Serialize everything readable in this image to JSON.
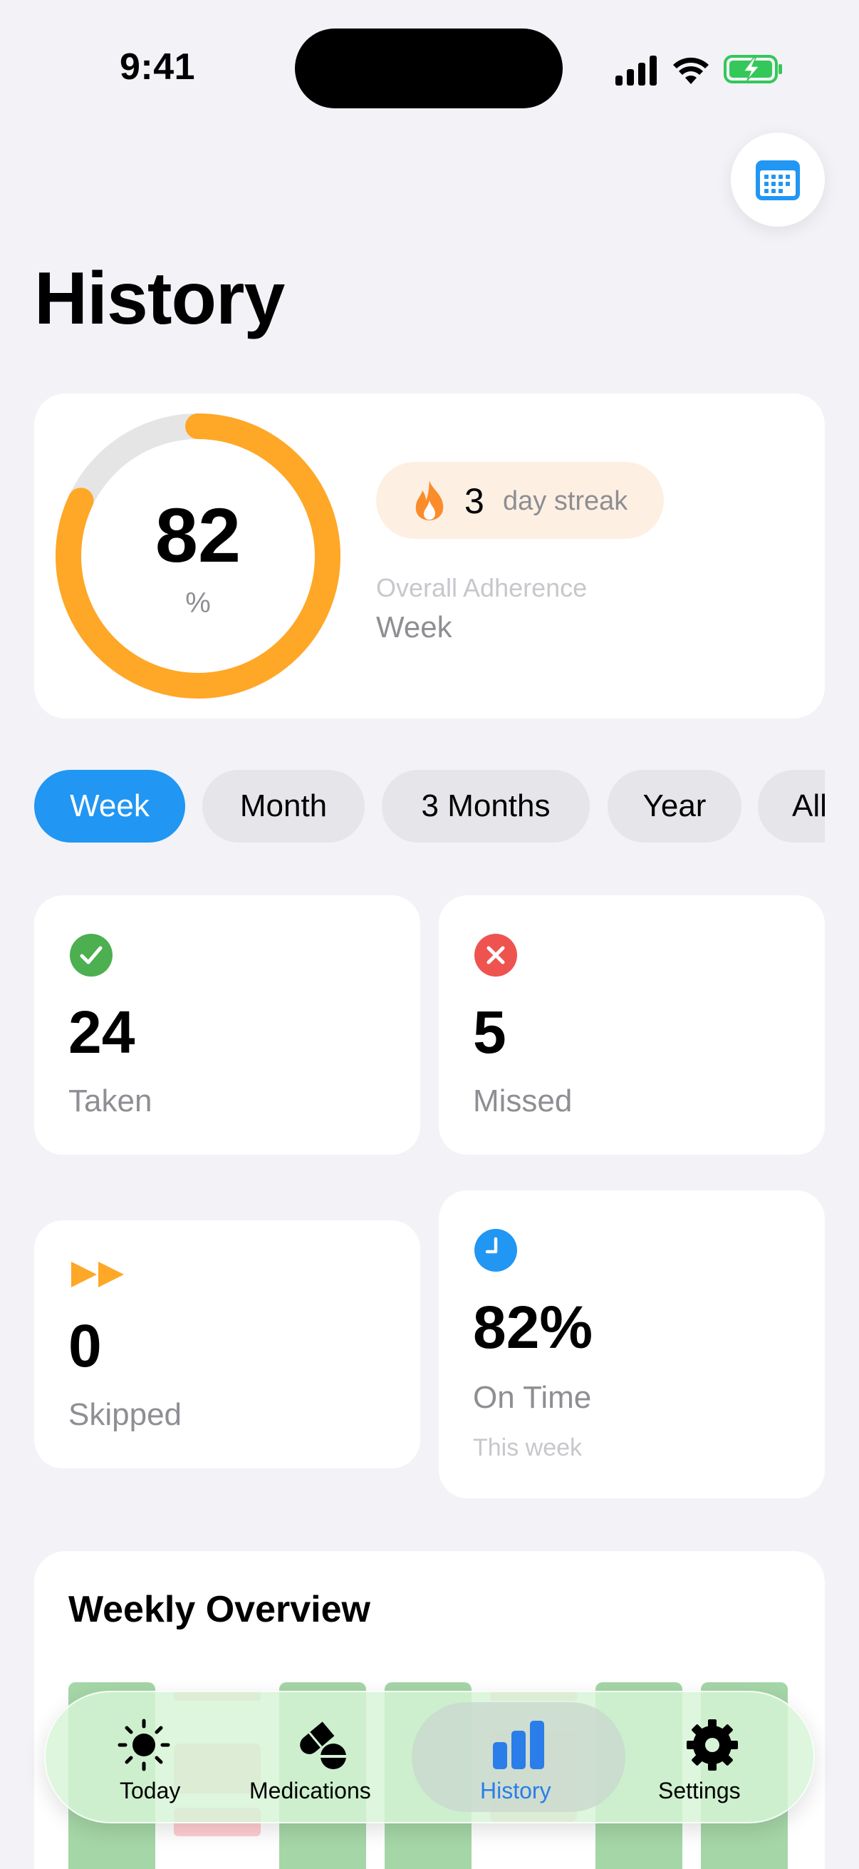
{
  "status_bar": {
    "time": "9:41"
  },
  "page": {
    "title": "History"
  },
  "adherence": {
    "percent": 0.82,
    "value": "82",
    "unit": "%",
    "streak_count": "3",
    "streak_label": "day streak",
    "label": "Overall Adherence",
    "period": "Week"
  },
  "periods": [
    "Week",
    "Month",
    "3 Months",
    "Year",
    "All"
  ],
  "selected_period": "Week",
  "stats": {
    "taken": {
      "value": "24",
      "label": "Taken"
    },
    "missed": {
      "value": "5",
      "label": "Missed"
    },
    "skipped": {
      "value": "0",
      "label": "Skipped"
    },
    "on_time": {
      "value": "82%",
      "label": "On Time",
      "sub": "This week"
    }
  },
  "weekly_overview": {
    "title": "Weekly Overview"
  },
  "tab_bar": {
    "tabs": [
      {
        "label": "Today",
        "icon": "sun-icon"
      },
      {
        "label": "Medications",
        "icon": "pills-icon"
      },
      {
        "label": "History",
        "icon": "chart-bar-icon"
      },
      {
        "label": "Settings",
        "icon": "gear-icon"
      }
    ],
    "active": "History"
  },
  "colors": {
    "accent": "#2196f3",
    "ring": "#ffa726",
    "ring_track": "#e5e5e5",
    "taken": "#4caf50",
    "missed": "#ef5350",
    "skipped": "#ffa726",
    "on_time": "#2196f3",
    "tab_active": "#2b7de9"
  }
}
